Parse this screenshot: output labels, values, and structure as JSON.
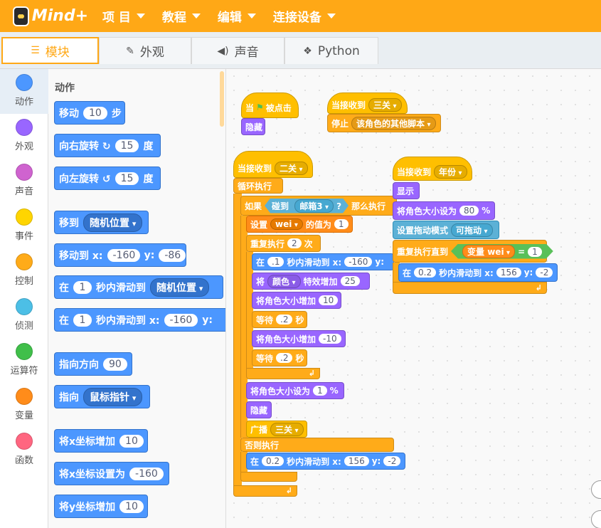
{
  "app": {
    "name": "Mind+"
  },
  "menu": [
    {
      "label": "项 目"
    },
    {
      "label": "教程"
    },
    {
      "label": "编辑"
    },
    {
      "label": "连接设备"
    }
  ],
  "tabs": [
    {
      "label": "模块",
      "icon": "blocks-icon",
      "active": true
    },
    {
      "label": "外观",
      "icon": "brush-icon"
    },
    {
      "label": "声音",
      "icon": "speaker-icon"
    },
    {
      "label": "Python",
      "icon": "python-icon"
    }
  ],
  "categories": [
    {
      "label": "动作",
      "color": "#4c97ff"
    },
    {
      "label": "外观",
      "color": "#9966ff"
    },
    {
      "label": "声音",
      "color": "#cf63cf"
    },
    {
      "label": "事件",
      "color": "#ffd500"
    },
    {
      "label": "控制",
      "color": "#ffab19"
    },
    {
      "label": "侦测",
      "color": "#4cbfe6"
    },
    {
      "label": "运算符",
      "color": "#40bf4a"
    },
    {
      "label": "变量",
      "color": "#ff8c1a"
    },
    {
      "label": "函数",
      "color": "#ff6680"
    }
  ],
  "palette": {
    "title": "动作",
    "blocks": [
      {
        "t1": "移动",
        "v1": "10",
        "t2": "步"
      },
      {
        "t1": "向右旋转 ↻",
        "v1": "15",
        "t2": "度"
      },
      {
        "t1": "向左旋转 ↺",
        "v1": "15",
        "t2": "度"
      },
      {
        "t1": "移到",
        "d1": "随机位置"
      },
      {
        "t1": "移动到 x:",
        "v1": "-160",
        "t2": "y:",
        "v2": "-86"
      },
      {
        "t1": "在",
        "v1": "1",
        "t2": "秒内滑动到",
        "d1": "随机位置"
      },
      {
        "t1": "在",
        "v1": "1",
        "t2": "秒内滑动到 x:",
        "v2": "-160",
        "t3": "y:"
      },
      {
        "t1": "指向方向",
        "v1": "90"
      },
      {
        "t1": "指向",
        "d1": "鼠标指针"
      },
      {
        "t1": "将x坐标增加",
        "v1": "10"
      },
      {
        "t1": "将x坐标设置为",
        "v1": "-160"
      },
      {
        "t1": "将y坐标增加",
        "v1": "10"
      }
    ]
  },
  "script": {
    "s1": {
      "hat": "当",
      "flag": "被点击",
      "b1": "隐藏"
    },
    "s2": {
      "hat": "当接收到",
      "hat_msg": "三关",
      "stop": "停止",
      "stop_opt": "该角色的其他脚本"
    },
    "s3": {
      "hat": "当接收到",
      "hat_msg": "二关",
      "forever": "循环执行",
      "if": "如果",
      "touch": "碰到",
      "touch_opt": "邮箱3",
      "q": "?",
      "then": "那么执行",
      "set": "设置",
      "set_var": "wei",
      "set_of": "的值为",
      "set_val": "1",
      "repeat": "重复执行",
      "repeat_n": "2",
      "repeat_unit": "次",
      "glide1": "在",
      "glide1_t": ".1",
      "glide1_mid": "秒内滑动到 x:",
      "glide1_x": "-160",
      "glide1_y": "y:",
      "effect": "将",
      "effect_opt": "颜色",
      "effect_mid": "特效增加",
      "effect_val": "25",
      "size_inc1": "将角色大小增加",
      "size_inc1_val": "10",
      "wait1": "等待",
      "wait1_val": ".2",
      "wait1_unit": "秒",
      "size_inc2": "将角色大小增加",
      "size_inc2_val": "-10",
      "wait2": "等待",
      "wait2_val": ".2",
      "wait2_unit": "秒",
      "size_set": "将角色大小设为",
      "size_set_val": "1",
      "size_set_unit": "%",
      "hide": "隐藏",
      "broadcast": "广播",
      "broadcast_msg": "三关",
      "else": "否则执行",
      "glide2": "在",
      "glide2_t": "0.2",
      "glide2_mid": "秒内滑动到 x:",
      "glide2_x": "156",
      "glide2_y": "y:",
      "glide2_yv": "-2"
    },
    "s4": {
      "hat": "当接收到",
      "hat_msg": "年份",
      "show": "显示",
      "size": "将角色大小设为",
      "size_val": "80",
      "size_unit": "%",
      "drag": "设置拖动模式",
      "drag_opt": "可拖动",
      "until": "重复执行直到",
      "var": "变量",
      "var_name": "wei",
      "eq": "=",
      "eq_val": "1",
      "glide": "在",
      "glide_t": "0.2",
      "glide_mid": "秒内滑动到 x:",
      "glide_x": "156",
      "glide_y": "y:",
      "glide_yv": "-2"
    }
  }
}
